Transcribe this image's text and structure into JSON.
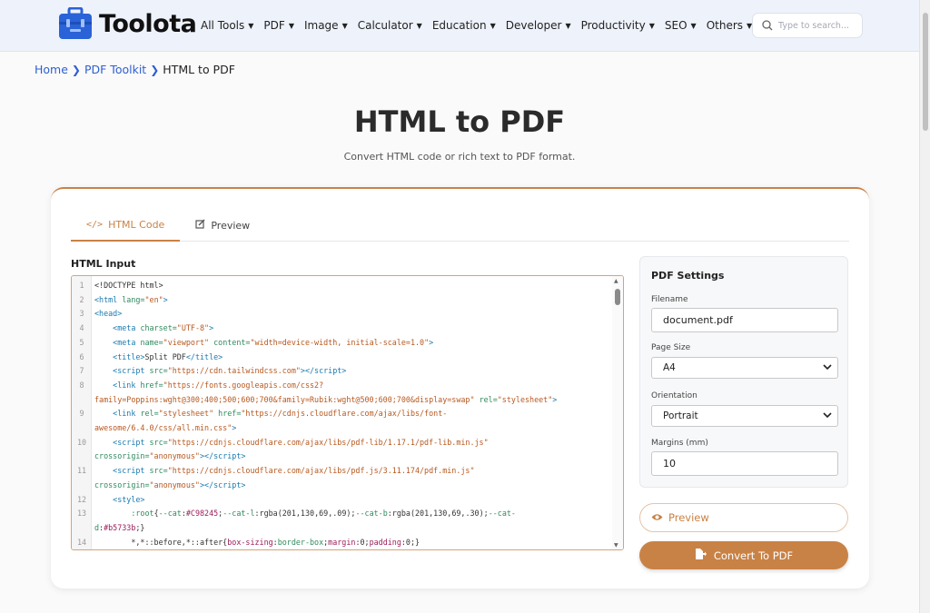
{
  "header": {
    "logo_text": "Toolota",
    "nav": [
      {
        "label": "All Tools"
      },
      {
        "label": "PDF"
      },
      {
        "label": "Image"
      },
      {
        "label": "Calculator"
      },
      {
        "label": "Education"
      },
      {
        "label": "Developer"
      },
      {
        "label": "Productivity"
      },
      {
        "label": "SEO"
      },
      {
        "label": "Others"
      }
    ],
    "search_placeholder": "Type to search..."
  },
  "breadcrumb": {
    "home": "Home",
    "section": "PDF Toolkit",
    "current": "HTML to PDF"
  },
  "page": {
    "title": "HTML to PDF",
    "subtitle": "Convert HTML code or rich text to PDF format."
  },
  "tabs": {
    "html_code": "HTML Code",
    "preview": "Preview"
  },
  "editor": {
    "label": "HTML Input"
  },
  "settings": {
    "title": "PDF Settings",
    "filename_label": "Filename",
    "filename_value": "document.pdf",
    "page_size_label": "Page Size",
    "page_size_value": "A4",
    "orientation_label": "Orientation",
    "orientation_value": "Portrait",
    "margins_label": "Margins (mm)",
    "margins_value": "10"
  },
  "buttons": {
    "preview": "Preview",
    "convert": "Convert To PDF"
  },
  "colors": {
    "accent": "#c98245",
    "link": "#2f5fd0"
  }
}
